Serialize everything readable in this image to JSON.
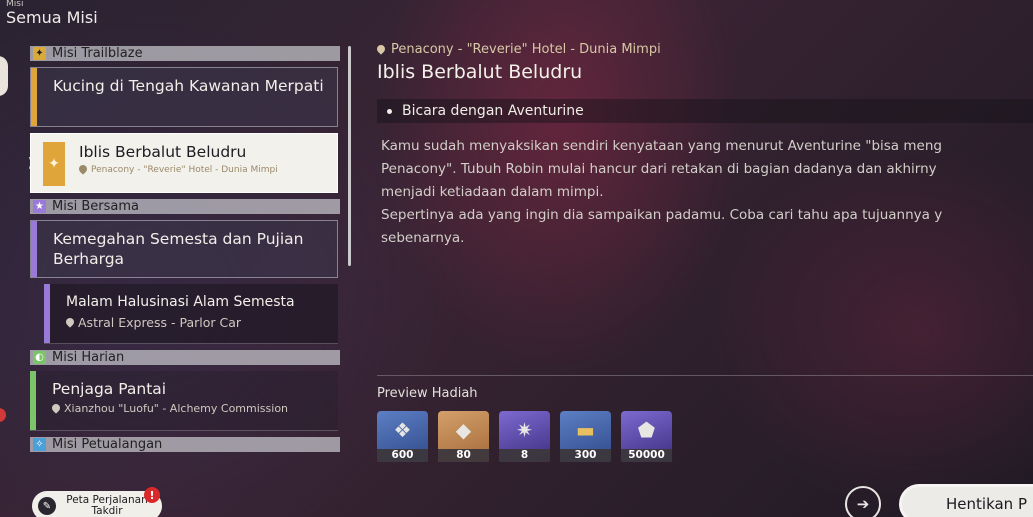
{
  "top": {
    "small_label": "Misi",
    "title": "Semua Misi"
  },
  "categories": {
    "trailblaze": "Misi Trailblaze",
    "bersama": "Misi Bersama",
    "harian": "Misi Harian",
    "petualangan": "Misi Petualangan"
  },
  "missions": {
    "kucing": {
      "name": "Kucing di Tengah Kawanan Merpati"
    },
    "iblis": {
      "name": "Iblis Berbalut Beludru",
      "location": "Penacony - \"Reverie\" Hotel - Dunia Mimpi"
    },
    "kemegahan": {
      "name": "Kemegahan Semesta dan Pujian Berharga"
    },
    "malam": {
      "name": "Malam Halusinasi Alam Semesta",
      "location": "Astral Express - Parlor Car"
    },
    "penjaga": {
      "name": "Penjaga Pantai",
      "location": "Xianzhou \"Luofu\" - Alchemy Commission"
    }
  },
  "detail": {
    "location": "Penacony - \"Reverie\" Hotel - Dunia Mimpi",
    "title": "Iblis Berbalut Beludru",
    "objective": "Bicara dengan Aventurine",
    "desc_lines": [
      "Kamu sudah menyaksikan sendiri kenyataan yang menurut Aventurine \"bisa meng",
      "Penacony\". Tubuh Robin mulai hancur dari retakan di bagian dadanya dan akhirny",
      "menjadi ketiadaan dalam mimpi.",
      "Sepertinya ada yang ingin dia sampaikan padamu. Coba cari tahu apa tujuannya y",
      "sebenarnya."
    ]
  },
  "rewards": {
    "title": "Preview Hadiah",
    "items": [
      {
        "qty": "600",
        "icon": "stellar-jade-icon"
      },
      {
        "qty": "80",
        "icon": "material-icon"
      },
      {
        "qty": "8",
        "icon": "purple-item-icon"
      },
      {
        "qty": "300",
        "icon": "ticket-icon"
      },
      {
        "qty": "50000",
        "icon": "credit-icon"
      }
    ]
  },
  "buttons": {
    "fate_map": "Peta Perjalanan Takdir",
    "fate_badge": "!",
    "stop": "Hentikan P"
  },
  "colors": {
    "trailblaze_accent": "#e0a53a",
    "bersama_accent": "#9a7ad8",
    "harian_accent": "#7bc46a",
    "petualangan_accent": "#4aa0d8"
  }
}
